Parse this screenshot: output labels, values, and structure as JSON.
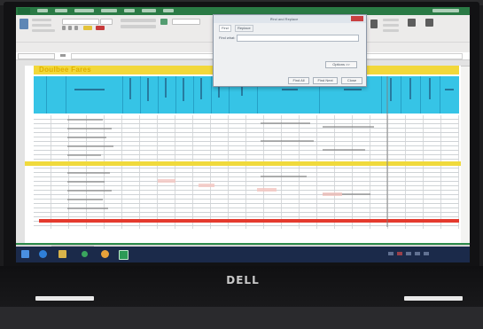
{
  "excel": {
    "banner_text": "Doulbee Fares",
    "dialog": {
      "title": "Find and Replace",
      "help_glyph": "?",
      "tabs": [
        "Find",
        "Replace"
      ],
      "find_label": "Find what:",
      "options_label": "Options >>",
      "buttons": [
        "Find All",
        "Find Next",
        "Close"
      ]
    },
    "sheet_tabs": [
      "",
      ""
    ]
  },
  "taskbar": {
    "clock_time": "",
    "clock_date": ""
  },
  "laptop": {
    "brand": "DELL"
  },
  "colors": {
    "banner_yellow": "#f2d83a",
    "header_cyan": "#36c4e6",
    "highlight_row_yellow": "#f0da3c",
    "highlight_row_red": "#e43a2e",
    "ribbon_green": "#2a7a45",
    "taskbar": "#1b2a4a"
  },
  "icons": [
    "windows-start-icon",
    "edge-browser-icon",
    "file-explorer-icon",
    "store-icon",
    "chrome-icon",
    "excel-icon"
  ]
}
